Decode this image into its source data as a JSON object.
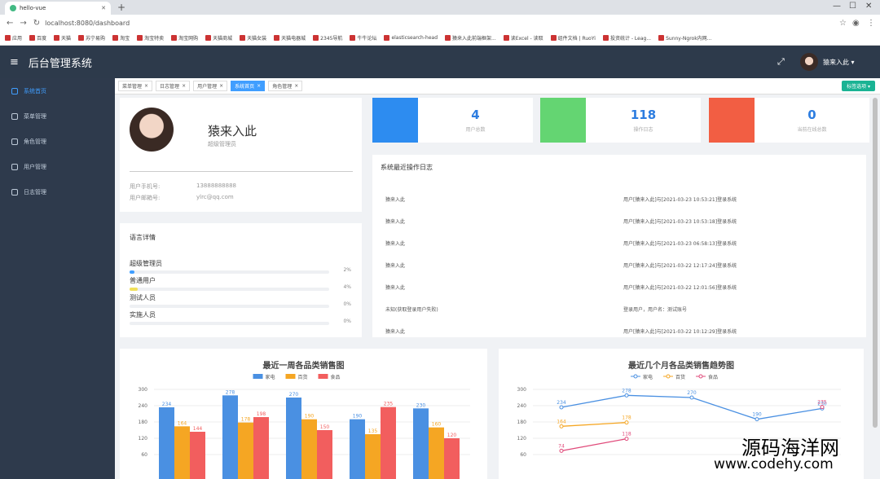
{
  "browser": {
    "tab_title": "hello-vue",
    "url": "localhost:8080/dashboard",
    "bookmarks": [
      "应用",
      "百度",
      "天猫",
      "苏宁易购",
      "淘宝",
      "淘宝特卖",
      "淘宝网购",
      "天猫商城",
      "天猫女装",
      "天猫电器城",
      "2345导航",
      "牛牛论坛",
      "elasticsearch-head",
      "猿来入此前端框架...",
      "读Excel - 读取",
      "组件文档 | RuoYi",
      "投资统计 - Leag...",
      "Sunny-Ngrok内网..."
    ]
  },
  "header": {
    "system_name": "后台管理系统",
    "user_name": "猿来入此"
  },
  "sidebar": {
    "items": [
      {
        "label": "系统首页",
        "active": true
      },
      {
        "label": "菜单管理"
      },
      {
        "label": "角色管理"
      },
      {
        "label": "用户管理"
      },
      {
        "label": "日志管理"
      }
    ]
  },
  "tags": {
    "items": [
      {
        "label": "菜单管理"
      },
      {
        "label": "日志管理"
      },
      {
        "label": "用户管理"
      },
      {
        "label": "系统首页",
        "active": true
      },
      {
        "label": "角色管理"
      }
    ],
    "close_label": "标签选项"
  },
  "profile": {
    "name": "猿来入此",
    "role": "超级管理员",
    "phone_label": "用户手机号:",
    "phone": "13888888888",
    "email_label": "用户邮箱号:",
    "email": "ylrc@qq.com"
  },
  "language": {
    "title": "语言详情",
    "items": [
      {
        "label": "超级管理员",
        "percent": "2%",
        "value": 0.02,
        "color": "#409eff"
      },
      {
        "label": "普通用户",
        "percent": "4%",
        "value": 0.04,
        "color": "#f1e05a"
      },
      {
        "label": "测试人员",
        "percent": "0%",
        "value": 0,
        "color": "#999999"
      },
      {
        "label": "实施人员",
        "percent": "0%",
        "value": 0,
        "color": "#999999"
      }
    ]
  },
  "stats": [
    {
      "value": "4",
      "label": "用户总数",
      "color": "#2d8cf0"
    },
    {
      "value": "118",
      "label": "操作日志",
      "color": "#64d572"
    },
    {
      "value": "0",
      "label": "当前在线总数",
      "color": "#f25e43"
    }
  ],
  "operation_log": {
    "title": "系统最近操作日志",
    "rows": [
      {
        "user": "猿来入此",
        "content": "用户[猿来入此]与[2021-03-23 10:53:21]登录系统"
      },
      {
        "user": "猿来入此",
        "content": "用户[猿来入此]与[2021-03-23 10:53:18]登录系统"
      },
      {
        "user": "猿来入此",
        "content": "用户[猿来入此]与[2021-03-23 06:58:13]登录系统"
      },
      {
        "user": "猿来入此",
        "content": "用户[猿来入此]与[2021-03-22 12:17:24]登录系统"
      },
      {
        "user": "猿来入此",
        "content": "用户[猿来入此]与[2021-03-22 12:01:56]登录系统"
      },
      {
        "user": "未知(获取登录用户失败)",
        "content": "登录用户，用户名：测试账号"
      },
      {
        "user": "猿来入此",
        "content": "用户[猿来入此]与[2021-03-22 10:12:29]登录系统"
      }
    ]
  },
  "chart_data": [
    {
      "type": "bar",
      "title": "最近一周各品类销售图",
      "categories": [
        "",
        "",
        "",
        "",
        ""
      ],
      "series": [
        {
          "name": "家电",
          "values": [
            234,
            278,
            270,
            190,
            230
          ],
          "color": "#4a90e2"
        },
        {
          "name": "百货",
          "values": [
            164,
            178,
            190,
            135,
            160
          ],
          "color": "#f5a623"
        },
        {
          "name": "食品",
          "values": [
            144,
            198,
            150,
            235,
            120
          ],
          "color": "#f25e5e"
        }
      ],
      "yticks": [
        60,
        120,
        180,
        240,
        300
      ],
      "ylim": [
        0,
        300
      ]
    },
    {
      "type": "line",
      "title": "最近几个月各品类销售趋势图",
      "series": [
        {
          "name": "家电",
          "values": [
            234,
            278,
            270,
            190,
            230
          ],
          "color": "#4a90e2"
        },
        {
          "name": "百货",
          "values": [
            164,
            178,
            null,
            null,
            null
          ],
          "color": "#f5a623"
        },
        {
          "name": "食品",
          "values": [
            74,
            118,
            null,
            null,
            235
          ],
          "color": "#e04a7a"
        }
      ],
      "yticks": [
        60,
        120,
        180,
        240,
        300
      ],
      "ylim": [
        0,
        300
      ]
    }
  ],
  "watermark": {
    "line1": "源码海洋网",
    "line2": "www.codehy.com"
  }
}
